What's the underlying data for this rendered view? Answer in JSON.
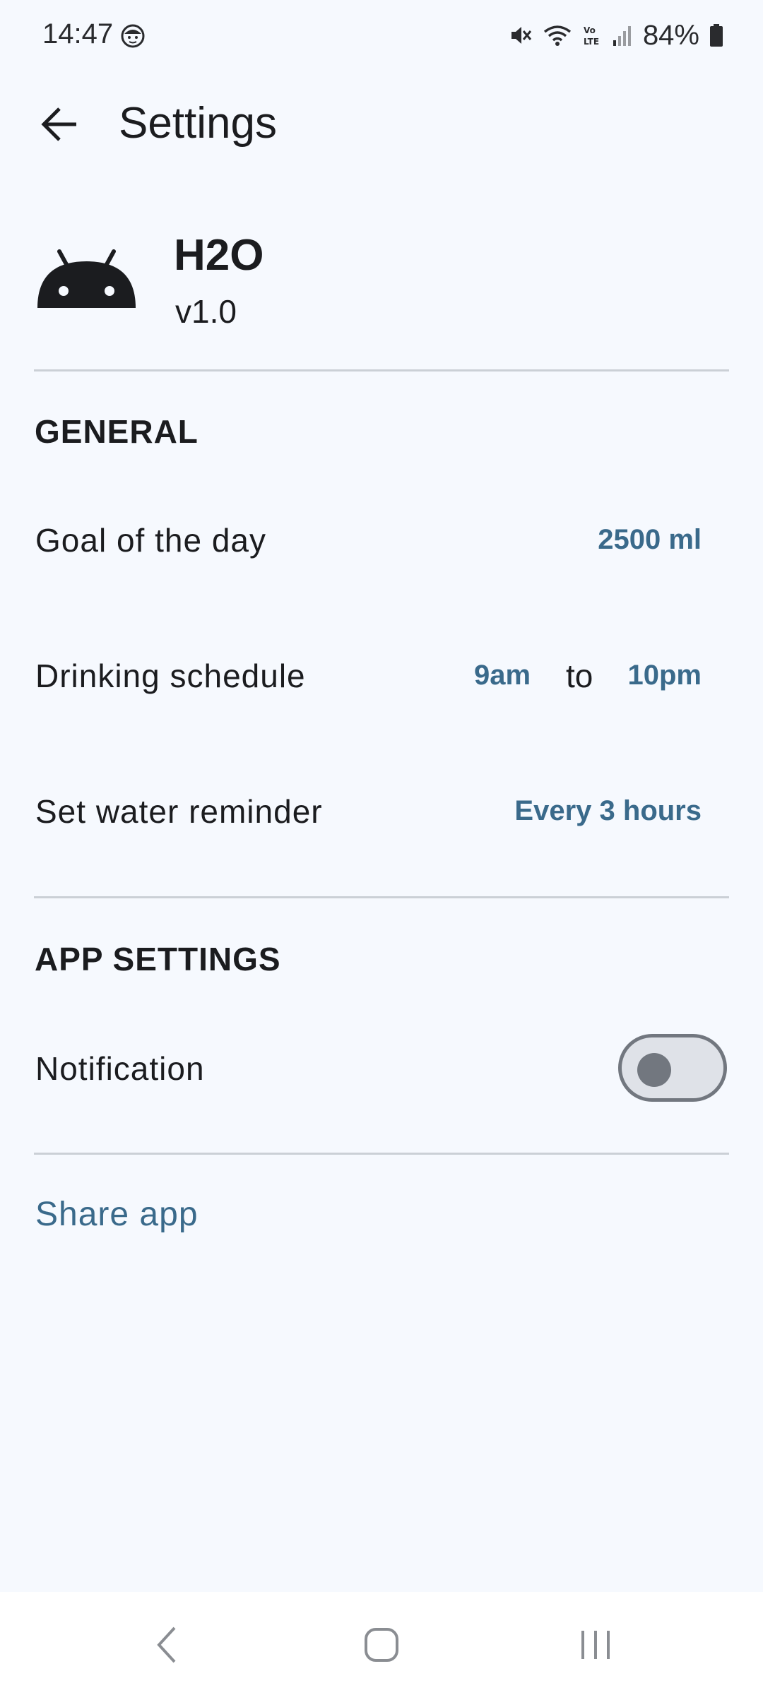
{
  "status_bar": {
    "time": "14:47",
    "battery": "84%",
    "icons": [
      "face-icon",
      "mute-icon",
      "wifi-icon",
      "volte-icon",
      "signal-icon",
      "battery-icon"
    ]
  },
  "app_bar": {
    "title": "Settings",
    "back_icon": "arrow-back-icon"
  },
  "app_info": {
    "name": "H2O",
    "version": "v1.0",
    "icon": "android-icon"
  },
  "general": {
    "title": "GENERAL",
    "goal": {
      "label": "Goal of the day",
      "value": "2500 ml"
    },
    "schedule": {
      "label": "Drinking schedule",
      "from": "9am",
      "separator": "to",
      "until": "10pm"
    },
    "reminder": {
      "label": "Set water reminder",
      "value": "Every 3 hours"
    }
  },
  "app_settings": {
    "title": "APP SETTINGS",
    "notification": {
      "label": "Notification",
      "enabled": false
    }
  },
  "share": {
    "label": "Share app"
  },
  "colors": {
    "background": "#f6f9fe",
    "accent": "#3a6a8b",
    "text": "#1b1c1f",
    "divider": "#cbd0d6"
  },
  "nav_bar": {
    "icons": [
      "nav-back-icon",
      "nav-home-icon",
      "nav-recents-icon"
    ]
  }
}
